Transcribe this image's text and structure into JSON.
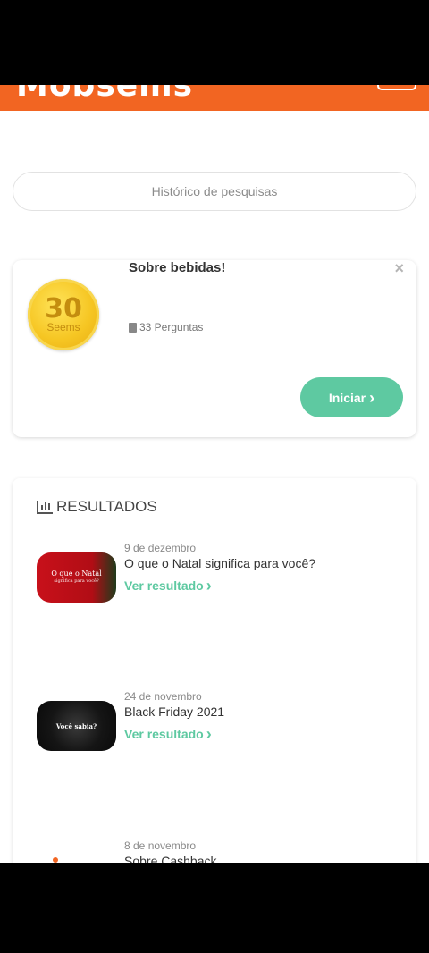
{
  "header": {
    "logo": "Mobsems"
  },
  "search_history": {
    "label": "Histórico de pesquisas"
  },
  "survey": {
    "coin_value": "30",
    "coin_unit": "Seems",
    "title": "Sobre bebidas!",
    "close": "×",
    "questions": "33 Perguntas",
    "start_label": "Iniciar",
    "start_arrow": "›"
  },
  "results": {
    "title": "RESULTADOS",
    "link_label": "Ver resultado",
    "link_arrow": "›",
    "items": [
      {
        "date": "9 de dezembro",
        "title": "O que o Natal significa para você?",
        "thumb_text": "O que o Natal",
        "thumb_sub": "significa para você?"
      },
      {
        "date": "24 de novembro",
        "title": "Black Friday 2021",
        "thumb_text": "Você sabia?"
      },
      {
        "date": "8 de novembro",
        "title": "Sobre Cashback"
      }
    ]
  },
  "colors": {
    "brand_orange": "#f26522",
    "accent_green": "#5ec9a1",
    "coin_gold": "#f6c623"
  }
}
